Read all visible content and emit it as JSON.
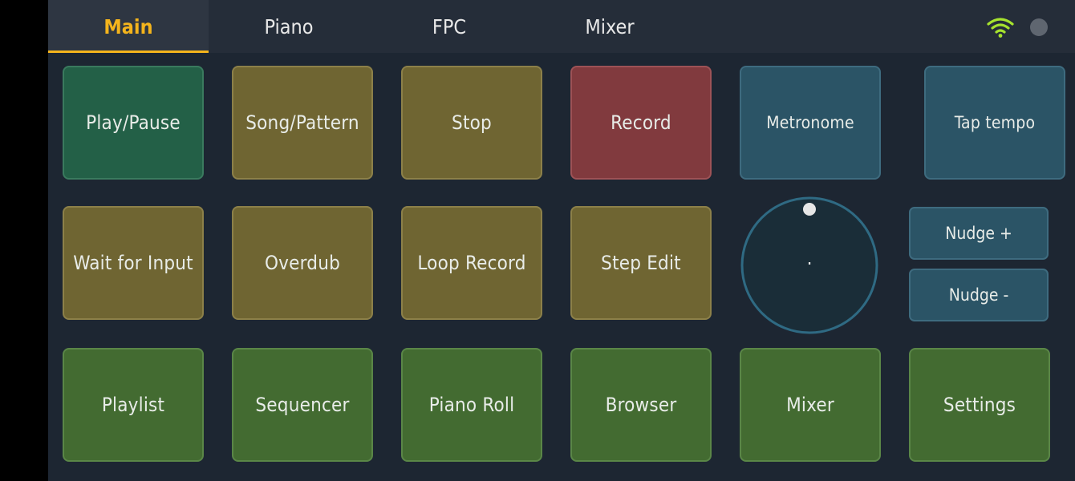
{
  "tabs": [
    {
      "label": "Main",
      "active": true
    },
    {
      "label": "Piano",
      "active": false
    },
    {
      "label": "FPC",
      "active": false
    },
    {
      "label": "Mixer",
      "active": false
    }
  ],
  "status": {
    "wifi_icon": "wifi-icon",
    "wifi_color": "#a6e22e",
    "indicator_color": "#5f6670"
  },
  "pads": {
    "play_pause": "Play/Pause",
    "song_pattern": "Song/Pattern",
    "stop": "Stop",
    "record": "Record",
    "metronome": "Metronome",
    "tap_tempo": "Tap tempo",
    "wait_for_input": "Wait for Input",
    "overdub": "Overdub",
    "loop_record": "Loop Record",
    "step_edit": "Step Edit",
    "playlist": "Playlist",
    "sequencer": "Sequencer",
    "piano_roll": "Piano Roll",
    "browser": "Browser",
    "mixer": "Mixer",
    "settings": "Settings"
  },
  "jog": {
    "nudge_plus": "Nudge +",
    "nudge_minus": "Nudge -",
    "center_mark": "·"
  },
  "colors": {
    "accent": "#f4b41c",
    "green_dark": "#236047",
    "olive": "#6f6532",
    "red": "#813a3e",
    "blue": "#2b5466",
    "green": "#436b31"
  }
}
